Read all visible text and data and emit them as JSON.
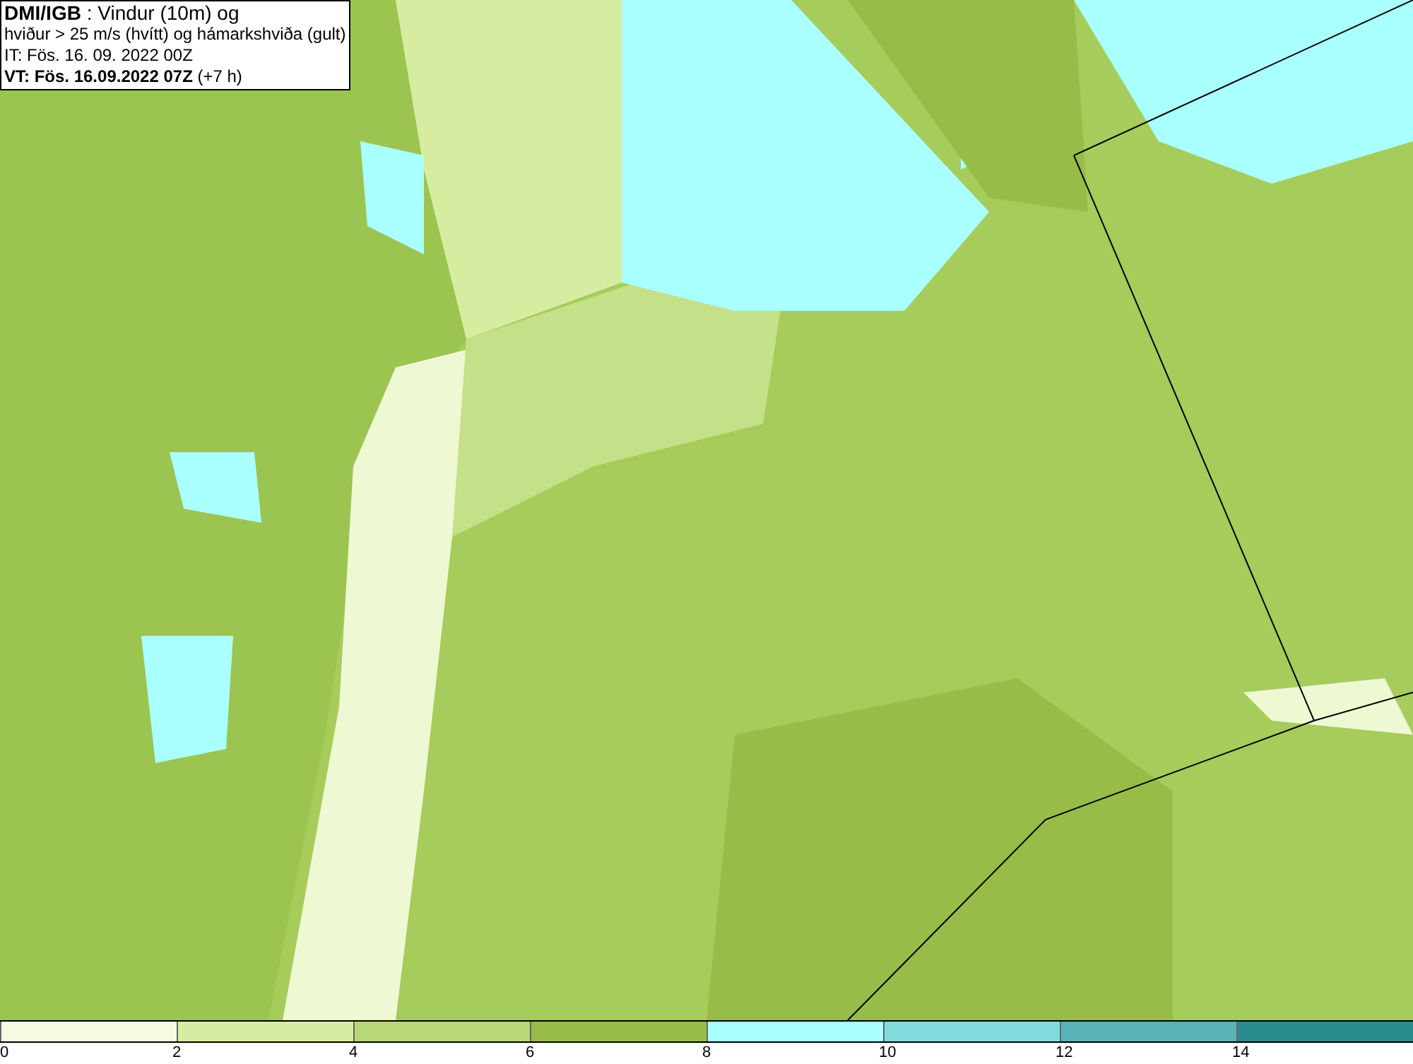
{
  "title_box": {
    "lines": [
      "**DMI/IGB** : Vindur (10m) og",
      "hviður > 25 m/s (hvítt) og hámarkshviða (gult)",
      "IT: Fös. 16. 09. 2022 00Z",
      "**VT: Fös. 16.09.2022 07Z** (+7 h)"
    ]
  },
  "legend": {
    "items": [
      {
        "label": "0",
        "color": "#f5fbe0"
      },
      {
        "label": "2",
        "color": "#d6eca0"
      },
      {
        "label": "4",
        "color": "#b8d878"
      },
      {
        "label": "6",
        "color": "#98bc48"
      },
      {
        "label": "8",
        "color": "#aaffff"
      },
      {
        "label": "10",
        "color": "#80dcdc"
      },
      {
        "label": "12",
        "color": "#58b4b4"
      },
      {
        "label": "14",
        "color": "#2a8c8c"
      }
    ]
  }
}
